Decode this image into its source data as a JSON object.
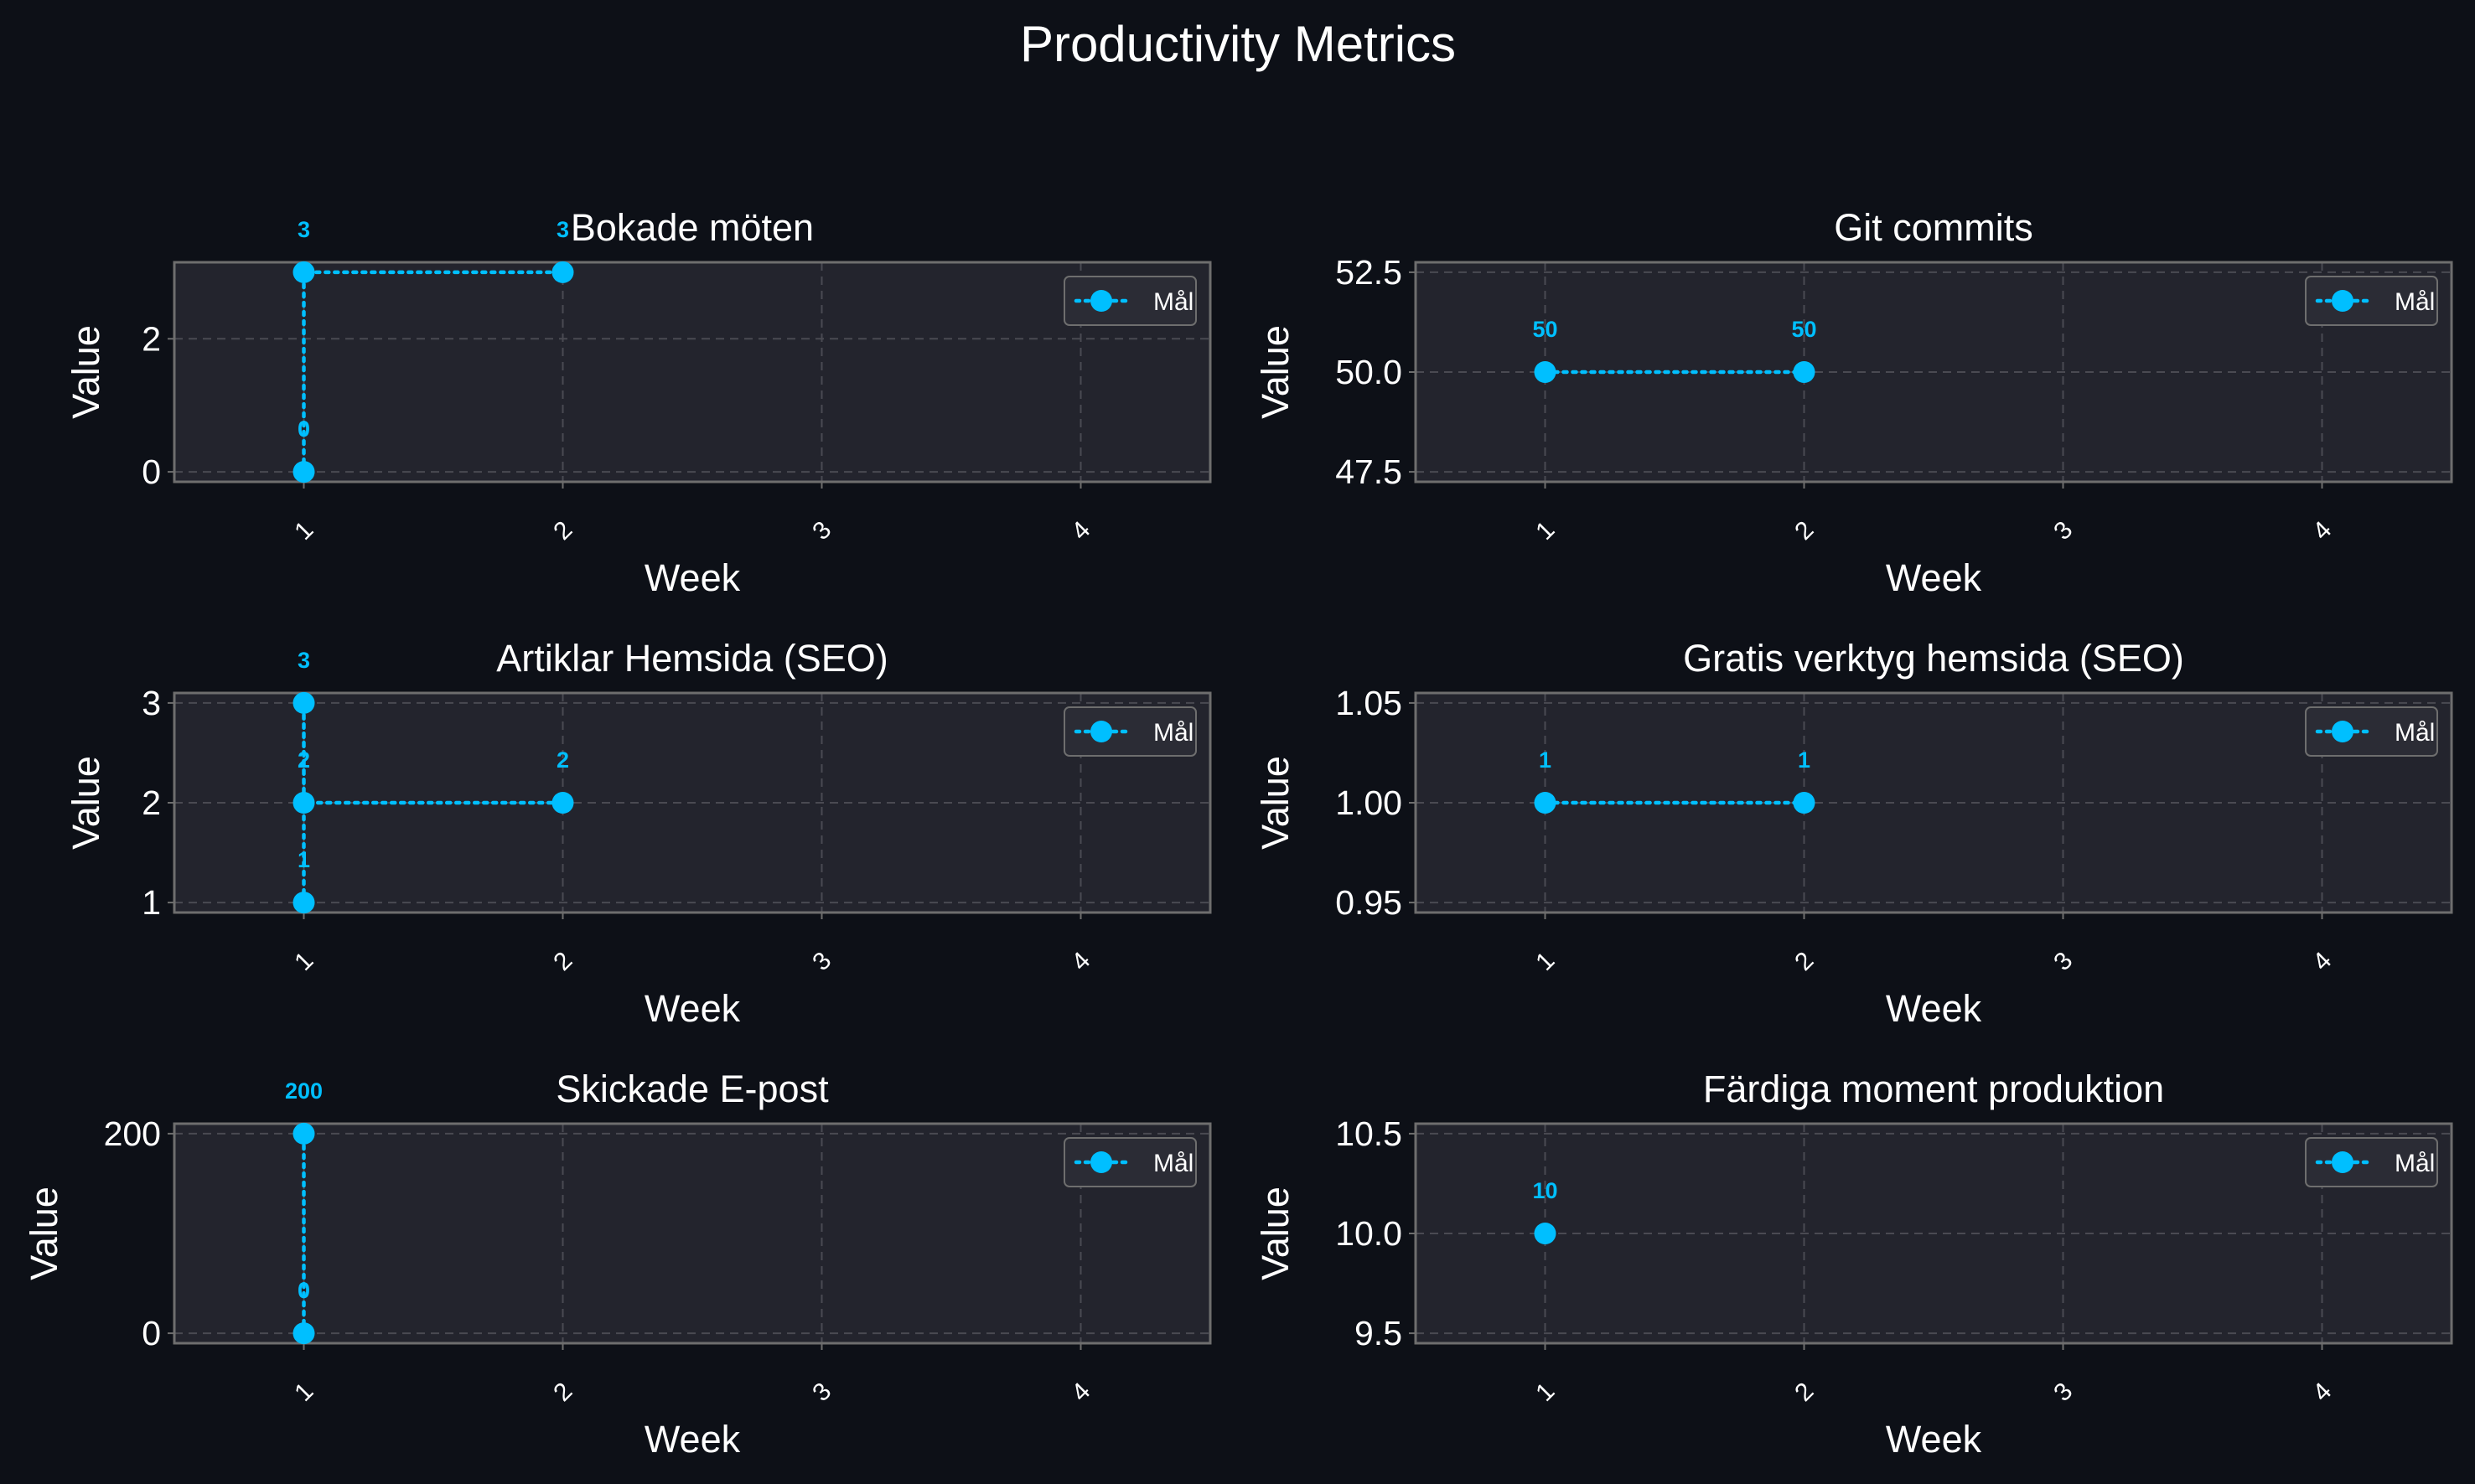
{
  "suptitle": "Productivity Metrics",
  "colors": {
    "background": "#0d1017",
    "axes_face": "#23242d",
    "spine": "#6e6e6e",
    "grid": "#4a4a52",
    "series": "#00bfff",
    "text": "#ffffff"
  },
  "chart_data": [
    {
      "type": "line",
      "title": "Bokade möten",
      "xlabel": "Week",
      "ylabel": "Value",
      "x_ticks": [
        "1",
        "2",
        "3",
        "4"
      ],
      "y_ticks": [
        "0",
        "2"
      ],
      "y_tick_values": [
        0,
        2
      ],
      "ylim": [
        -0.15,
        3.15
      ],
      "xlim": [
        0.5,
        4.5
      ],
      "grid": true,
      "legend": "upper right",
      "series": [
        {
          "name": "Mål",
          "style": "dotted-with-markers",
          "x": [
            1,
            1,
            2
          ],
          "y": [
            0,
            3,
            3
          ]
        }
      ]
    },
    {
      "type": "line",
      "title": "Git commits",
      "xlabel": "Week",
      "ylabel": "Value",
      "x_ticks": [
        "1",
        "2",
        "3",
        "4"
      ],
      "y_ticks": [
        "47.5",
        "50.0",
        "52.5"
      ],
      "y_tick_values": [
        47.5,
        50,
        52.5
      ],
      "ylim": [
        47.25,
        52.75
      ],
      "xlim": [
        0.5,
        4.5
      ],
      "grid": true,
      "legend": "upper right",
      "series": [
        {
          "name": "Mål",
          "style": "dotted-with-markers",
          "x": [
            1,
            2
          ],
          "y": [
            50,
            50
          ]
        }
      ]
    },
    {
      "type": "line",
      "title": "Artiklar Hemsida (SEO)",
      "xlabel": "Week",
      "ylabel": "Value",
      "x_ticks": [
        "1",
        "2",
        "3",
        "4"
      ],
      "y_ticks": [
        "1",
        "2",
        "3"
      ],
      "y_tick_values": [
        1,
        2,
        3
      ],
      "ylim": [
        0.9,
        3.1
      ],
      "xlim": [
        0.5,
        4.5
      ],
      "grid": true,
      "legend": "upper right",
      "series": [
        {
          "name": "Mål",
          "style": "dotted-with-markers",
          "x": [
            1,
            1,
            1,
            2
          ],
          "y": [
            1,
            3,
            2,
            2
          ]
        }
      ]
    },
    {
      "type": "line",
      "title": "Gratis verktyg hemsida (SEO)",
      "xlabel": "Week",
      "ylabel": "Value",
      "x_ticks": [
        "1",
        "2",
        "3",
        "4"
      ],
      "y_ticks": [
        "0.95",
        "1.00",
        "1.05"
      ],
      "y_tick_values": [
        0.95,
        1.0,
        1.05
      ],
      "ylim": [
        0.945,
        1.055
      ],
      "xlim": [
        0.5,
        4.5
      ],
      "grid": true,
      "legend": "upper right",
      "series": [
        {
          "name": "Mål",
          "style": "dotted-with-markers",
          "x": [
            1,
            2
          ],
          "y": [
            1,
            1
          ]
        }
      ]
    },
    {
      "type": "line",
      "title": "Skickade E-post",
      "xlabel": "Week",
      "ylabel": "Value",
      "x_ticks": [
        "1",
        "2",
        "3",
        "4"
      ],
      "y_ticks": [
        "0",
        "200"
      ],
      "y_tick_values": [
        0,
        200
      ],
      "ylim": [
        -10,
        210
      ],
      "xlim": [
        0.5,
        4.5
      ],
      "grid": true,
      "legend": "upper right",
      "series": [
        {
          "name": "Mål",
          "style": "dotted-with-markers",
          "x": [
            1,
            1
          ],
          "y": [
            0,
            200
          ]
        }
      ]
    },
    {
      "type": "line",
      "title": "Färdiga moment produktion",
      "xlabel": "Week",
      "ylabel": "Value",
      "x_ticks": [
        "1",
        "2",
        "3",
        "4"
      ],
      "y_ticks": [
        "9.5",
        "10.0",
        "10.5"
      ],
      "y_tick_values": [
        9.5,
        10.0,
        10.5
      ],
      "ylim": [
        9.45,
        10.55
      ],
      "xlim": [
        0.5,
        4.5
      ],
      "grid": true,
      "legend": "upper right",
      "series": [
        {
          "name": "Mål",
          "style": "dotted-with-markers",
          "x": [
            1
          ],
          "y": [
            10
          ]
        }
      ]
    }
  ]
}
